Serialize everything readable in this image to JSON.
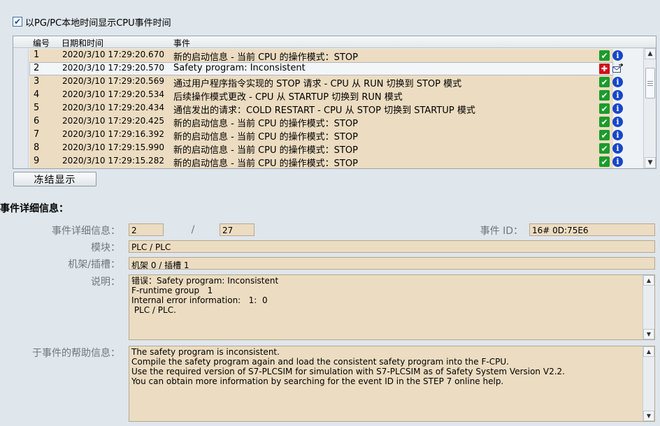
{
  "top_checkbox": {
    "checked": true,
    "mark": "✔",
    "label": "以PG/PC本地时间显示CPU事件时间"
  },
  "table": {
    "headers": {
      "num": "编号",
      "date": "日期和时间",
      "event": "事件"
    },
    "rows": [
      {
        "num": "1",
        "date": "2020/3/10 17:29:20.670",
        "event": "新的启动信息 - 当前 CPU 的操作模式：STOP",
        "icon_a": "ok-icon",
        "icon_b": "info-icon"
      },
      {
        "num": "2",
        "date": "2020/3/10 17:29:20.570",
        "event": "Safety program: Inconsistent",
        "icon_a": "error-icon",
        "icon_b": "mail-arrow-icon",
        "selected": true
      },
      {
        "num": "3",
        "date": "2020/3/10 17:29:20.569",
        "event": "通过用户程序指令实现的 STOP 请求 - CPU 从 RUN 切换到 STOP 模式",
        "icon_a": "ok-icon",
        "icon_b": "info-icon"
      },
      {
        "num": "4",
        "date": "2020/3/10 17:29:20.534",
        "event": "后续操作模式更改 - CPU 从 STARTUP 切换到 RUN 模式",
        "icon_a": "ok-icon",
        "icon_b": "info-icon"
      },
      {
        "num": "5",
        "date": "2020/3/10 17:29:20.434",
        "event": "通信发出的请求：COLD RESTART - CPU 从 STOP 切换到 STARTUP 模式",
        "icon_a": "ok-icon",
        "icon_b": "info-icon"
      },
      {
        "num": "6",
        "date": "2020/3/10 17:29:20.425",
        "event": "新的启动信息 - 当前 CPU 的操作模式：STOP",
        "icon_a": "ok-icon",
        "icon_b": "info-icon"
      },
      {
        "num": "7",
        "date": "2020/3/10 17:29:16.392",
        "event": "新的启动信息 - 当前 CPU 的操作模式：STOP",
        "icon_a": "ok-icon",
        "icon_b": "info-icon"
      },
      {
        "num": "8",
        "date": "2020/3/10 17:29:15.990",
        "event": "新的启动信息 - 当前 CPU 的操作模式：STOP",
        "icon_a": "ok-icon",
        "icon_b": "info-icon"
      },
      {
        "num": "9",
        "date": "2020/3/10 17:29:15.282",
        "event": "新的启动信息 - 当前 CPU 的操作模式：STOP",
        "icon_a": "ok-icon",
        "icon_b": "info-icon"
      }
    ]
  },
  "freeze_button": "冻结显示",
  "details": {
    "title": "事件详细信息：",
    "detail_label": "事件详细信息：",
    "detail_value": "2",
    "detail_sep": "/",
    "detail_total": "27",
    "event_id_label": "事件 ID：",
    "event_id_value": "16# 0D:75E6",
    "module_label": "模块：",
    "module_value": "PLC / PLC",
    "rack_label": "机架/插槽：",
    "rack_value": "机架 0 / 插槽 1",
    "desc_label": "说明：",
    "desc_lines": [
      "错误：Safety program: Inconsistent",
      "F-runtime group   1",
      "Internal error information:   1:  0",
      " PLC / PLC."
    ],
    "help_label": "于事件的帮助信息：",
    "help_lines": [
      "The safety program is inconsistent.",
      "Compile the safety program again and load the consistent safety program into the F-CPU.",
      "Use the required version of S7-PLCSIM for simulation with S7-PLCSIM as of Safety System Version V2.2.",
      "You can obtain more information by searching for the event ID in the STEP 7 online help."
    ]
  },
  "colors": {
    "row_bg": "#ecdcc1",
    "ok": "#1a9c2c",
    "info": "#1646c9",
    "error": "#d0111b"
  }
}
